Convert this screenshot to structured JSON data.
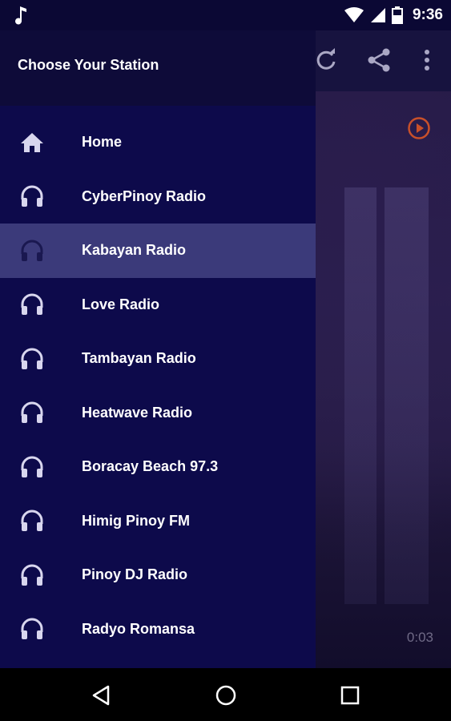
{
  "status_bar": {
    "time": "9:36",
    "icons": [
      "music-note-icon",
      "wifi-icon",
      "cell-signal-icon",
      "battery-icon"
    ]
  },
  "toolbar": {
    "icons": [
      "refresh-icon",
      "share-icon",
      "more-vert-icon"
    ]
  },
  "drawer": {
    "title": "Choose Your Station",
    "items": [
      {
        "label": "Home",
        "icon": "home-icon",
        "selected": false
      },
      {
        "label": "CyberPinoy Radio",
        "icon": "headphones-icon",
        "selected": false
      },
      {
        "label": "Kabayan Radio",
        "icon": "headphones-icon",
        "selected": true
      },
      {
        "label": "Love Radio",
        "icon": "headphones-icon",
        "selected": false
      },
      {
        "label": "Tambayan Radio",
        "icon": "headphones-icon",
        "selected": false
      },
      {
        "label": "Heatwave Radio",
        "icon": "headphones-icon",
        "selected": false
      },
      {
        "label": "Boracay Beach 97.3",
        "icon": "headphones-icon",
        "selected": false
      },
      {
        "label": "Himig Pinoy FM",
        "icon": "headphones-icon",
        "selected": false
      },
      {
        "label": "Pinoy DJ Radio",
        "icon": "headphones-icon",
        "selected": false
      },
      {
        "label": "Radyo Romansa",
        "icon": "headphones-icon",
        "selected": false
      }
    ]
  },
  "player": {
    "elapsed": "0:03",
    "play_icon": "play-circle-icon"
  },
  "nav_bar": {
    "icons": [
      "back-icon",
      "home-circle-icon",
      "recents-icon"
    ]
  },
  "colors": {
    "drawer_bg": "#0d0a4b",
    "selected_bg": "#3b3a7a",
    "accent": "#c8502a"
  }
}
